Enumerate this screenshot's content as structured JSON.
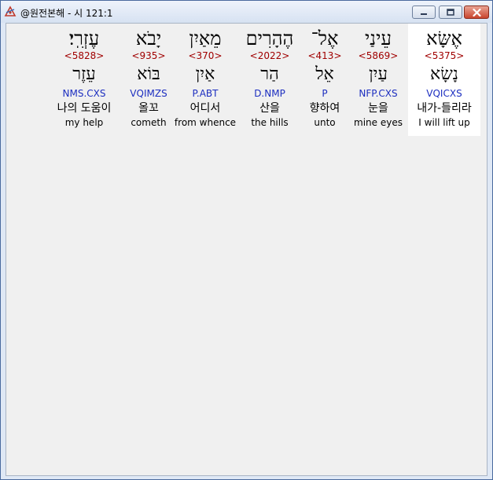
{
  "window": {
    "title": "@원전본해 - 시 121:1"
  },
  "words": [
    {
      "hebrew": "עֶזְרִֽי׃",
      "strong": "<5828>",
      "lemma": "עֵזֶר",
      "parse": "NMS.CXS",
      "korean": "나의 도움이",
      "english": "my help",
      "selected": false
    },
    {
      "hebrew": "יָבֹא",
      "strong": "<935>",
      "lemma": "בּוֹא",
      "parse": "VQIMZS",
      "korean": "올꼬",
      "english": "cometh",
      "selected": false
    },
    {
      "hebrew": "מֵאַיִן",
      "strong": "<370>",
      "lemma": "אַיִן",
      "parse": "P.ABT",
      "korean": "어디서",
      "english": "from whence",
      "selected": false
    },
    {
      "hebrew": "הֶהָרִים",
      "strong": "<2022>",
      "lemma": "הַר",
      "parse": "D.NMP",
      "korean": "산을",
      "english": "the hills",
      "selected": false
    },
    {
      "hebrew": "אֶל־",
      "strong": "<413>",
      "lemma": "אֵל",
      "parse": "P",
      "korean": "향하여",
      "english": "unto",
      "selected": false
    },
    {
      "hebrew": "עֵינַי",
      "strong": "<5869>",
      "lemma": "עַיִן",
      "parse": "NFP.CXS",
      "korean": "눈을",
      "english": "mine eyes",
      "selected": false
    },
    {
      "hebrew": "אֶשָּׂא",
      "strong": "<5375>",
      "lemma": "נָשָׂא",
      "parse": "VQICXS",
      "korean": "내가-들리라",
      "english": "I will lift up",
      "selected": true
    }
  ]
}
